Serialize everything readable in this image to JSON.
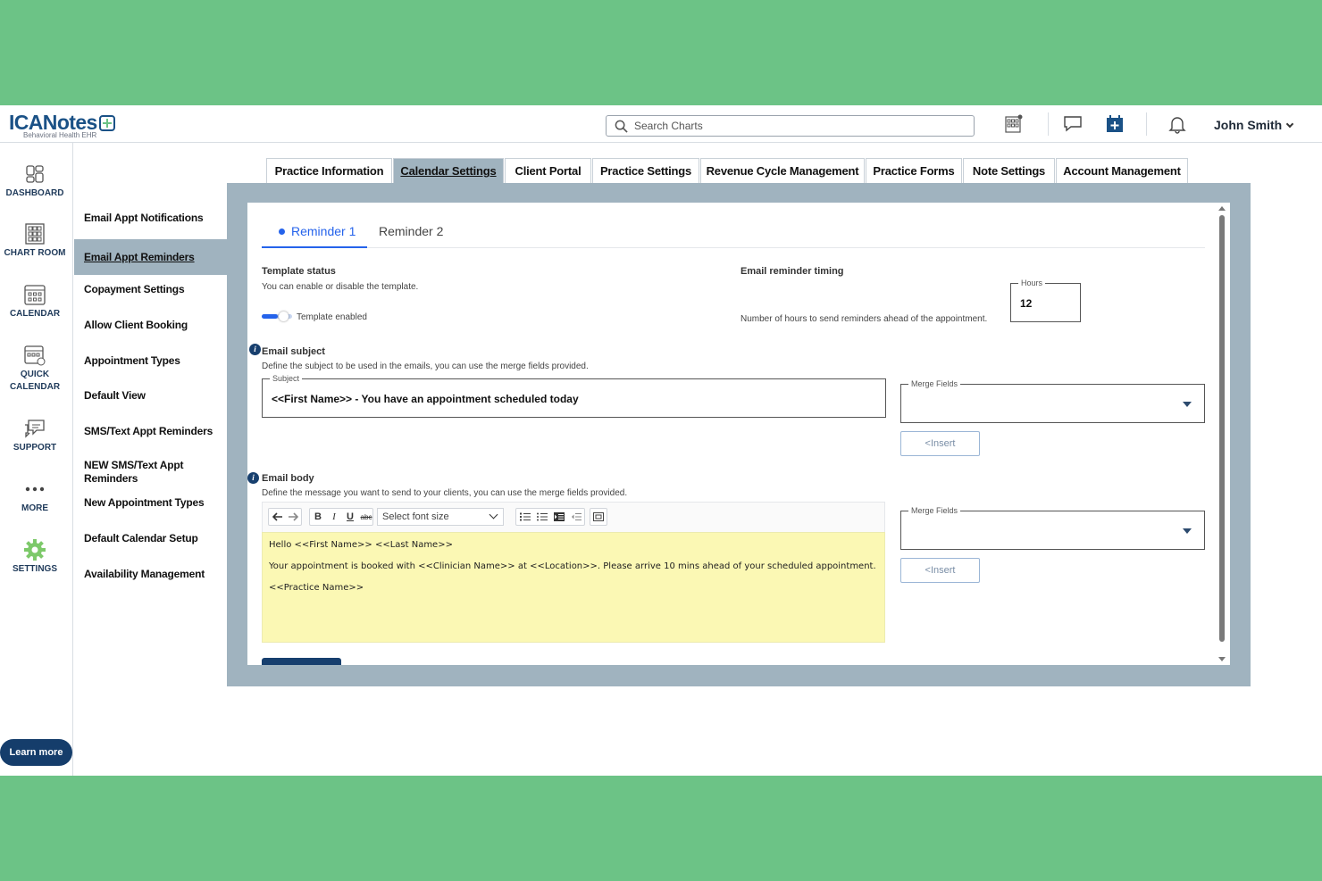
{
  "header": {
    "logo_main": "ICANotes",
    "logo_sub": "Behavioral Health EHR",
    "search_placeholder": "Search Charts",
    "user_name": "John Smith",
    "icons": [
      "chart-room-icon",
      "message-icon",
      "add-appointment-icon",
      "bell-icon"
    ]
  },
  "leftnav": {
    "items": [
      {
        "label": "DASHBOARD",
        "icon": "dashboard-icon"
      },
      {
        "label": "CHART ROOM",
        "icon": "chart-room-icon"
      },
      {
        "label": "CALENDAR",
        "icon": "calendar-icon"
      },
      {
        "label": "QUICK CALENDAR",
        "icon": "quick-calendar-icon"
      },
      {
        "label": "SUPPORT",
        "icon": "support-icon"
      },
      {
        "label": "MORE",
        "icon": "more-icon"
      },
      {
        "label": "SETTINGS",
        "icon": "gear-icon"
      }
    ],
    "learn_more": "Learn more"
  },
  "subnav": {
    "items": [
      "Email Appt Notifications",
      "Email Appt Reminders",
      "Copayment Settings",
      "Allow Client Booking",
      "Appointment Types",
      "Default View",
      "SMS/Text Appt Reminders",
      "NEW SMS/Text Appt Reminders",
      "New Appointment Types",
      "Default Calendar Setup",
      "Availability Management"
    ],
    "active": "Email Appt Reminders"
  },
  "tabs": {
    "items": [
      "Practice Information",
      "Calendar Settings",
      "Client Portal",
      "Practice Settings",
      "Revenue Cycle Management",
      "Practice Forms",
      "Note Settings",
      "Account Management"
    ],
    "active": "Calendar Settings"
  },
  "reminder_tabs": {
    "items": [
      "Reminder 1",
      "Reminder 2"
    ],
    "active": "Reminder 1"
  },
  "template_status": {
    "title": "Template status",
    "desc": "You can enable or disable the template.",
    "toggle_label": "Template enabled",
    "enabled": true
  },
  "timing": {
    "title": "Email reminder timing",
    "desc": "Number of hours to send reminders ahead of the appointment.",
    "hours_label": "Hours",
    "hours_value": "12"
  },
  "email_subject": {
    "title": "Email subject",
    "desc": "Define the subject to be used in the emails, you can use the merge fields provided.",
    "subject_label": "Subject",
    "subject_value": "<<First Name>> - You have an appointment scheduled today",
    "merge_label": "Merge Fields",
    "insert_label": "<Insert"
  },
  "email_body": {
    "title": "Email body",
    "desc": "Define the message you want to send to your clients, you can use the merge fields provided.",
    "font_size_placeholder": "Select font size",
    "lines": [
      "Hello <<First Name>> <<Last Name>>",
      "Your appointment is booked with <<Clinician Name>> at <<Location>>. Please arrive 10 mins ahead of your scheduled appointment.",
      "<<Practice Name>>"
    ],
    "merge_label": "Merge Fields",
    "insert_label": "<Insert"
  },
  "colors": {
    "background": "#6cc386",
    "brand": "#1a5186",
    "panel": "#a0b3bf",
    "accent": "#2563eb",
    "editor_bg": "#fbf8b4"
  }
}
